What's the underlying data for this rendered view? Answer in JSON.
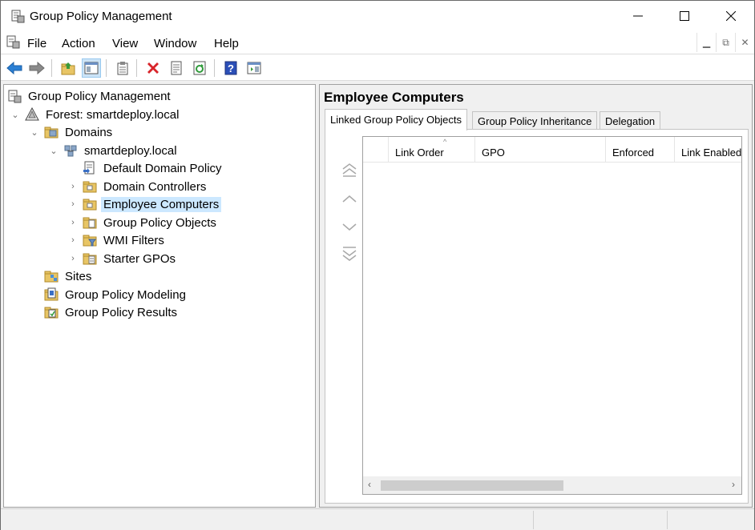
{
  "window": {
    "title": "Group Policy Management",
    "controls": [
      "minimize-icon",
      "maximize-icon",
      "close-icon"
    ]
  },
  "menu": {
    "items": [
      "File",
      "Action",
      "View",
      "Window",
      "Help"
    ]
  },
  "toolbar": {
    "buttons": [
      "back-arrow-icon",
      "forward-arrow-icon",
      "up-folder-icon",
      "show-hide-console-tree-icon",
      "clipboard-icon",
      "delete-icon",
      "properties-icon",
      "refresh-icon",
      "help-icon",
      "action-pane-icon"
    ]
  },
  "tree": {
    "root": "Group Policy Management",
    "forest": "Forest: smartdeploy.local",
    "domains": "Domains",
    "domain": "smartdeploy.local",
    "items": [
      "Default Domain Policy",
      "Domain Controllers",
      "Employee Computers",
      "Group Policy Objects",
      "WMI Filters",
      "Starter GPOs"
    ],
    "selected": "Employee Computers",
    "sites": "Sites",
    "modeling": "Group Policy Modeling",
    "results": "Group Policy Results"
  },
  "details": {
    "heading": "Employee Computers",
    "tabs": [
      "Linked Group Policy Objects",
      "Group Policy Inheritance",
      "Delegation"
    ],
    "active_tab": "Linked Group Policy Objects",
    "columns": [
      "Link Order",
      "GPO",
      "Enforced",
      "Link Enabled"
    ]
  },
  "colors": {
    "selection": "#cce8ff",
    "toolbar_active": "#cce4f7",
    "folder": "#e8c565"
  }
}
